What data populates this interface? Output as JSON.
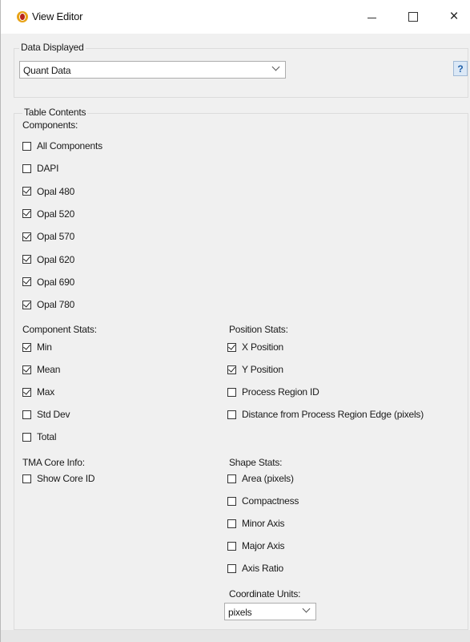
{
  "window": {
    "title": "View Editor",
    "close_glyph": "×"
  },
  "data_displayed": {
    "legend": "Data Displayed",
    "selected": "Quant Data",
    "help_label": "?"
  },
  "table_contents": {
    "legend": "Table Contents",
    "components_label": "Components:",
    "components": [
      {
        "label": "All Components",
        "checked": false
      },
      {
        "label": "DAPI",
        "checked": false
      },
      {
        "label": "Opal 480",
        "checked": true
      },
      {
        "label": "Opal 520",
        "checked": true
      },
      {
        "label": "Opal 570",
        "checked": true
      },
      {
        "label": "Opal 620",
        "checked": true
      },
      {
        "label": "Opal 690",
        "checked": true
      },
      {
        "label": "Opal 780",
        "checked": true
      }
    ],
    "component_stats_label": "Component Stats:",
    "component_stats": [
      {
        "label": "Min",
        "checked": true
      },
      {
        "label": "Mean",
        "checked": true
      },
      {
        "label": "Max",
        "checked": true
      },
      {
        "label": "Std Dev",
        "checked": false
      },
      {
        "label": "Total",
        "checked": false
      }
    ],
    "position_stats_label": "Position Stats:",
    "position_stats": [
      {
        "label": "X Position",
        "checked": true
      },
      {
        "label": "Y Position",
        "checked": true
      },
      {
        "label": "Process Region ID",
        "checked": false
      },
      {
        "label": "Distance from Process Region Edge (pixels)",
        "checked": false
      }
    ],
    "tma_label": "TMA Core Info:",
    "tma": [
      {
        "label": "Show Core ID",
        "checked": false
      }
    ],
    "shape_stats_label": "Shape Stats:",
    "shape_stats": [
      {
        "label": "Area (pixels)",
        "checked": false
      },
      {
        "label": "Compactness",
        "checked": false
      },
      {
        "label": "Minor Axis",
        "checked": false
      },
      {
        "label": "Major Axis",
        "checked": false
      },
      {
        "label": "Axis Ratio",
        "checked": false
      }
    ],
    "coordinate_units_label": "Coordinate Units:",
    "coordinate_units_selected": "pixels"
  }
}
